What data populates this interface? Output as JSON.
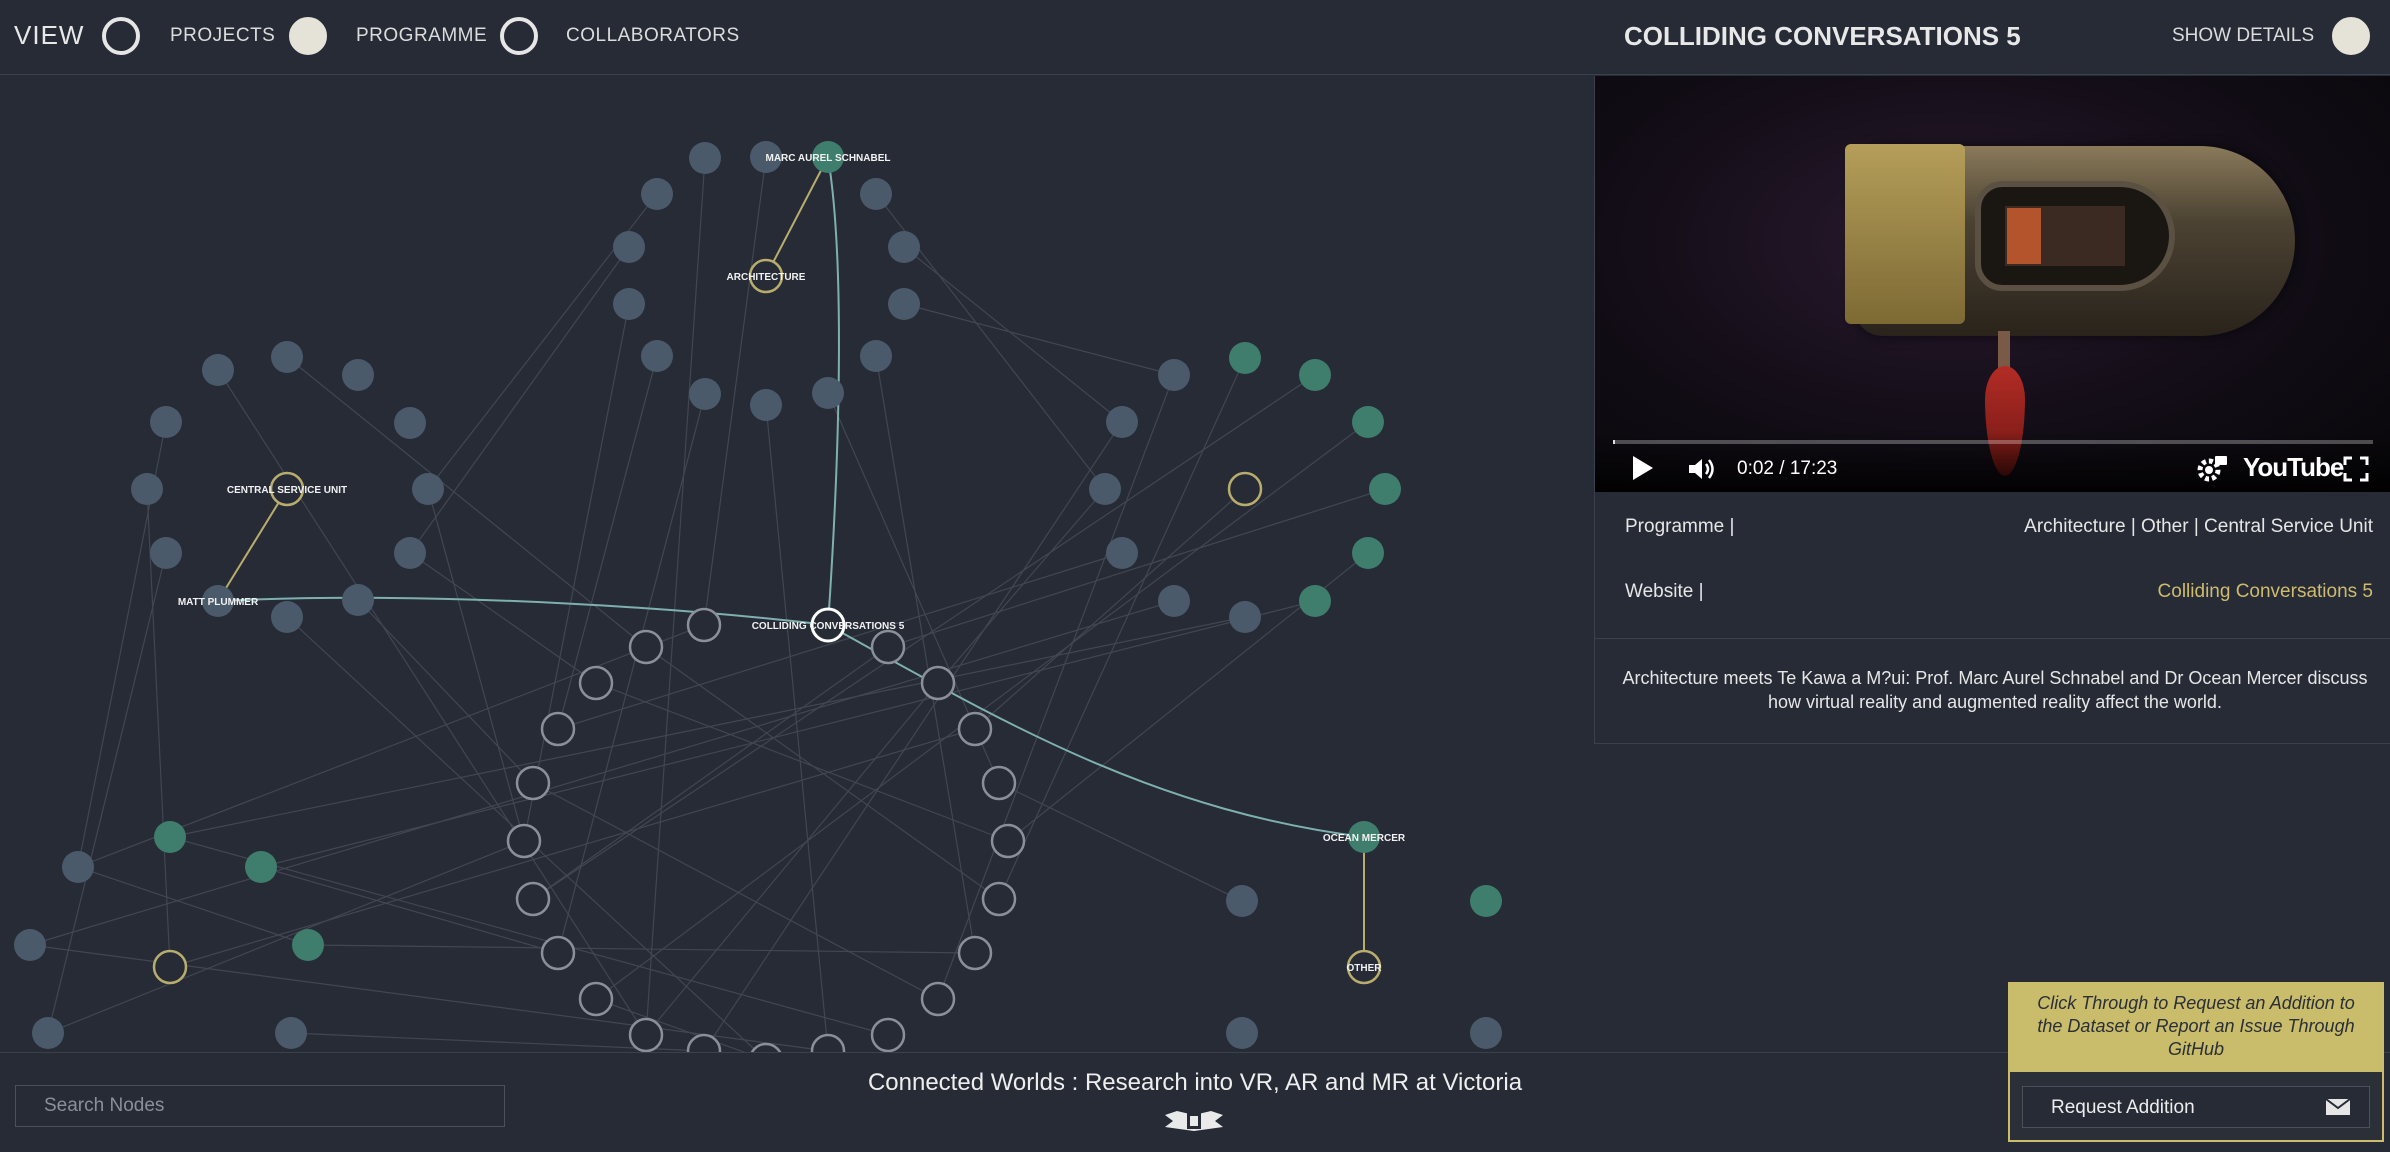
{
  "header": {
    "view_label": "VIEW",
    "toggles": [
      {
        "label": "PROJECTS",
        "on": false
      },
      {
        "label": "PROGRAMME",
        "on": true
      },
      {
        "label": "COLLABORATORS",
        "on": false
      }
    ],
    "selected_title": "COLLIDING CONVERSATIONS 5",
    "show_details_label": "SHOW DETAILS"
  },
  "graph": {
    "labels": {
      "schnabel": "MARC AUREL SCHNABEL",
      "architecture": "ARCHITECTURE",
      "csu": "CENTRAL SERVICE UNIT",
      "plummer": "MATT PLUMMER",
      "colliding": "COLLIDING CONVERSATIONS 5",
      "mercer": "OCEAN MERCER",
      "other": "OTHER"
    }
  },
  "video": {
    "time": "0:02 / 17:23",
    "progress": 0.002,
    "logo": "YouTube"
  },
  "details": {
    "programme_key": "Programme |",
    "programme_value": "Architecture | Other | Central Service Unit",
    "website_key": "Website |",
    "website_value": "Colliding Conversations 5",
    "description": "Architecture meets Te Kawa a M?ui: Prof. Marc Aurel Schnabel and Dr Ocean Mercer discuss how virtual reality and augmented reality affect the world."
  },
  "footer": {
    "search_placeholder": "Search Nodes",
    "title": "Connected Worlds : Research into VR, AR and MR at Victoria"
  },
  "request": {
    "note": "Click Through to Request an Addition to the Dataset or Report an Issue Through GitHub",
    "button_label": "Request Addition"
  },
  "icons": {
    "play": "play-icon",
    "volume": "volume-icon",
    "settings": "gear-icon",
    "fullscreen": "fullscreen-icon",
    "mail": "mail-icon"
  },
  "colors": {
    "background": "#262b36",
    "accent_gold": "#c9bc6a",
    "node_green": "#3f7d6c",
    "node_blue": "#4a5a6a",
    "highlight_link": "#7fb0b0"
  }
}
